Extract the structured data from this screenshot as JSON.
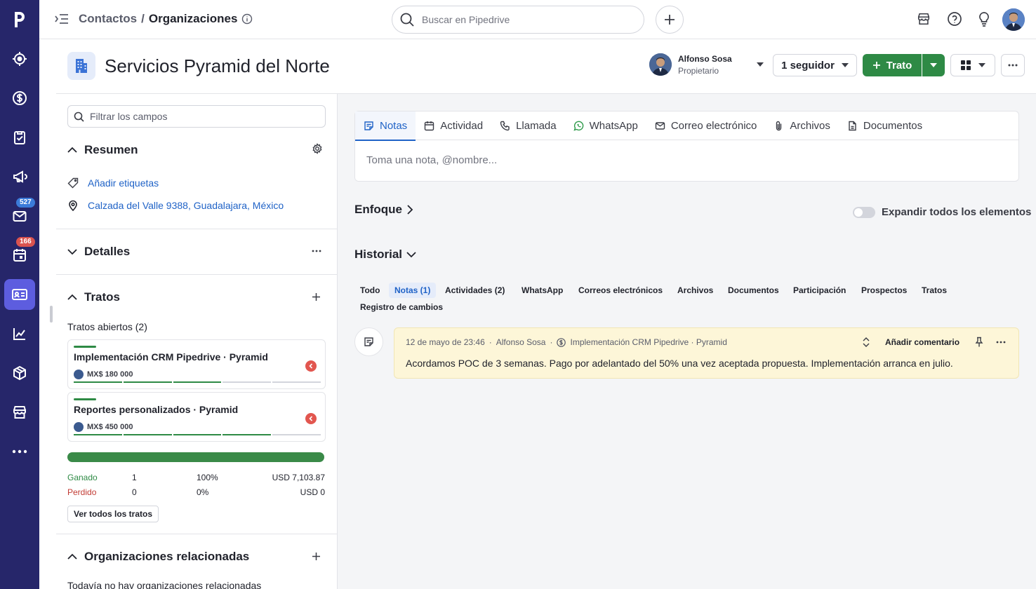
{
  "nav": {
    "badges": {
      "mail": "527",
      "calendar": "166"
    }
  },
  "topbar": {
    "breadcrumb_parent": "Contactos",
    "breadcrumb_sep": "/",
    "breadcrumb_current": "Organizaciones",
    "search_placeholder": "Buscar en Pipedrive"
  },
  "header": {
    "org_name": "Servicios Pyramid del Norte",
    "owner_name": "Alfonso Sosa",
    "owner_role": "Propietario",
    "followers_label": "1 seguidor",
    "deal_button": "Trato"
  },
  "left": {
    "filter_placeholder": "Filtrar los campos",
    "summary": {
      "title": "Resumen",
      "add_tags": "Añadir etiquetas",
      "address": "Calzada del Valle 9388, Guadalajara, México"
    },
    "details_title": "Detalles",
    "deals": {
      "title": "Tratos",
      "open_label": "Tratos abiertos (2)",
      "items": [
        {
          "title": "Implementación CRM Pipedrive · Pyramid",
          "value": "MX$ 180 000",
          "stages_done": 3
        },
        {
          "title": "Reportes personalizados · Pyramid",
          "value": "MX$ 450 000",
          "stages_done": 4
        }
      ],
      "won_label": "Ganado",
      "won_count": "1",
      "won_pct": "100%",
      "won_amount": "USD 7,103.87",
      "lost_label": "Perdido",
      "lost_count": "0",
      "lost_pct": "0%",
      "lost_amount": "USD 0",
      "see_all": "Ver todos los tratos"
    },
    "related": {
      "title": "Organizaciones relacionadas",
      "empty": "Todavía no hay organizaciones relacionadas"
    }
  },
  "main": {
    "tabs": [
      {
        "label": "Notas",
        "icon": "note-icon"
      },
      {
        "label": "Actividad",
        "icon": "calendar-icon"
      },
      {
        "label": "Llamada",
        "icon": "phone-icon"
      },
      {
        "label": "WhatsApp",
        "icon": "whatsapp-icon"
      },
      {
        "label": "Correo electrónico",
        "icon": "mail-icon"
      },
      {
        "label": "Archivos",
        "icon": "paperclip-icon"
      },
      {
        "label": "Documentos",
        "icon": "document-icon"
      }
    ],
    "note_placeholder": "Toma una nota, @nombre...",
    "focus_title": "Enfoque",
    "expand_label": "Expandir todos los elementos",
    "history_title": "Historial",
    "history_tabs": [
      "Todo",
      "Notas (1)",
      "Actividades (2)",
      "WhatsApp",
      "Correos electrónicos",
      "Archivos",
      "Documentos",
      "Participación",
      "Prospectos",
      "Tratos",
      "Registro de cambios"
    ],
    "note": {
      "date": "12 de mayo de 23:46",
      "author": "Alfonso Sosa",
      "deal": "Implementación CRM Pipedrive · Pyramid",
      "add_comment": "Añadir comentario",
      "body": "Acordamos POC de 3 semanas. Pago por adelantado del 50% una vez aceptada propuesta. Implementación arranca en julio."
    }
  },
  "colors": {
    "nav_bg": "#26266a",
    "nav_active": "#5d5ddf",
    "accent_green": "#2e8a45",
    "link_blue": "#2063c7",
    "note_bg": "#fdf6d8"
  }
}
